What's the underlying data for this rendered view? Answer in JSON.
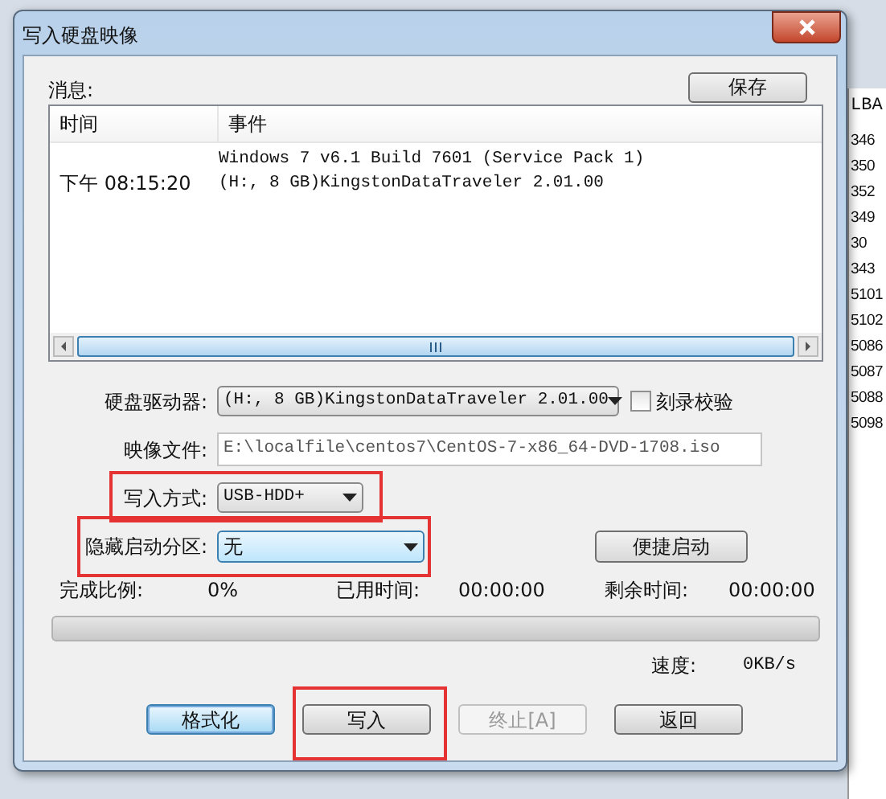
{
  "background_window": {
    "column_header": "LBA",
    "values": [
      "346",
      "350",
      "352",
      "349",
      "30",
      "343",
      "5101",
      "5102",
      "5086",
      "5087",
      "5088",
      "5098"
    ]
  },
  "window": {
    "title": "写入硬盘映像"
  },
  "messages": {
    "label": "消息:",
    "save_button": "保存",
    "columns": [
      "时间",
      "事件"
    ],
    "rows": [
      {
        "time": "下午 08:15:20",
        "event_lines": [
          "Windows 7 v6.1 Build 7601 (Service Pack 1)",
          "(H:, 8 GB)KingstonDataTraveler 2.01.00"
        ]
      }
    ]
  },
  "drive": {
    "label": "硬盘驱动器:",
    "value": "(H:, 8 GB)KingstonDataTraveler 2.01.00"
  },
  "verify": {
    "label": "刻录校验",
    "checked": false
  },
  "image_file": {
    "label": "映像文件:",
    "value": "E:\\localfile\\centos7\\CentOS-7-x86_64-DVD-1708.iso"
  },
  "write_mode": {
    "label": "写入方式:",
    "value": "USB-HDD+",
    "highlighted": true
  },
  "hidden_partition": {
    "label": "隐藏启动分区:",
    "value": "无",
    "highlighted": true
  },
  "quick_boot_button": "便捷启动",
  "progress": {
    "done_label": "完成比例:",
    "done_value": "0%",
    "elapsed_label": "已用时间:",
    "elapsed_value": "00:00:00",
    "remaining_label": "剩余时间:",
    "remaining_value": "00:00:00",
    "level": 0
  },
  "speed": {
    "label": "速度:",
    "value": "0KB/s"
  },
  "buttons": [
    {
      "label": "格式化",
      "kind": "default",
      "disabled": false,
      "highlighted": false
    },
    {
      "label": "写入",
      "kind": "normal",
      "disabled": false,
      "highlighted": true
    },
    {
      "label": "终止[A]",
      "kind": "normal",
      "disabled": true,
      "highlighted": false
    },
    {
      "label": "返回",
      "kind": "normal",
      "disabled": false,
      "highlighted": false
    }
  ]
}
